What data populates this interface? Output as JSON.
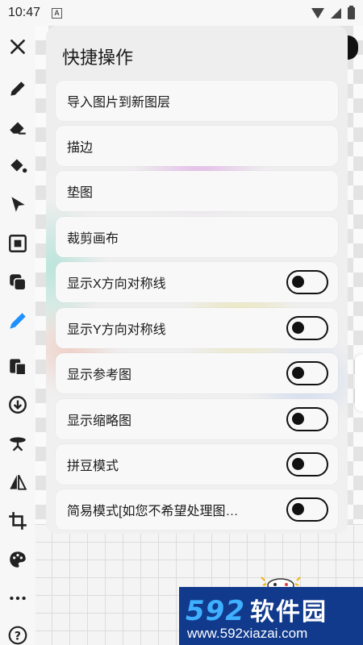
{
  "status_bar": {
    "time": "10:47",
    "badge": "A"
  },
  "panel": {
    "title": "快捷操作",
    "items": [
      {
        "label": "导入图片到新图层"
      },
      {
        "label": "描边"
      },
      {
        "label": "垫图"
      },
      {
        "label": "裁剪画布"
      },
      {
        "label": "显示X方向对称线",
        "toggle": false
      },
      {
        "label": "显示Y方向对称线",
        "toggle": false
      },
      {
        "label": "显示参考图",
        "toggle": false
      },
      {
        "label": "显示缩略图",
        "toggle": false
      },
      {
        "label": "拼豆模式",
        "toggle": false
      },
      {
        "label": "简易模式[如您不希望处理图…",
        "toggle": false
      }
    ]
  },
  "toolbar": {
    "tools": [
      "close-icon",
      "pencil-icon",
      "eraser-icon",
      "fill-bucket-icon",
      "select-arrow-icon",
      "fit-screen-icon",
      "layers-icon",
      "eyedropper-icon",
      "paste-icon",
      "import-icon",
      "stool-icon",
      "flip-icon",
      "crop-icon",
      "palette-icon",
      "more-icon",
      "help-icon"
    ],
    "accent": "#1e90ff"
  },
  "watermark": {
    "number": "592",
    "text": "软件园",
    "url": "www.592xiazai.com"
  }
}
